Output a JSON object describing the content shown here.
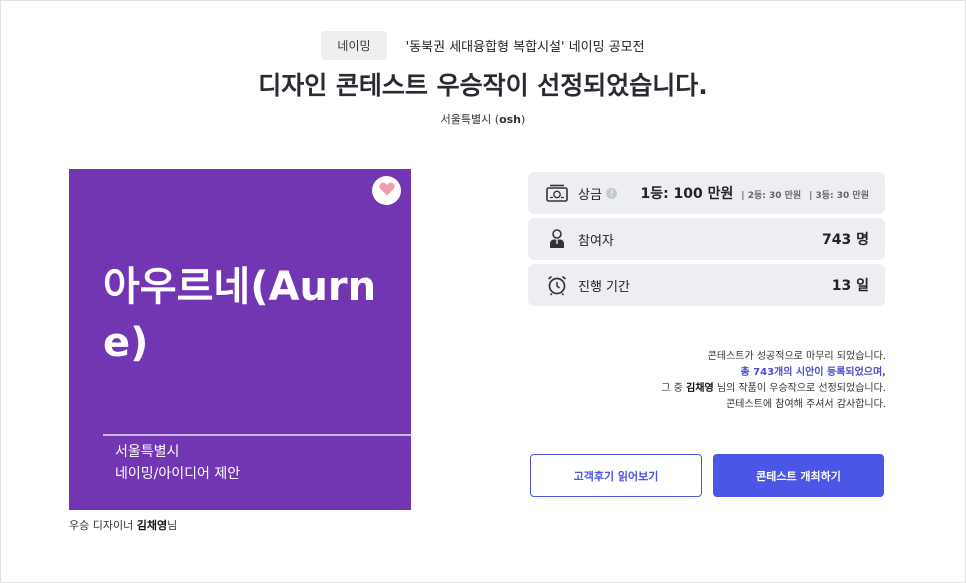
{
  "header": {
    "badge": "네이밍",
    "contest_name": "'동북권 세대융합형 복합시설' 네이밍 공모전",
    "title": "디자인 콘테스트 우승작이 선정되었습니다.",
    "host_name": "서울특별시",
    "host_id": "osh"
  },
  "artwork": {
    "background_color": "#7236b3",
    "heart_icon": "heart-icon",
    "title": "아우르네(Aurne)",
    "line1": "서울특별시",
    "line2": "네이밍/아이디어 제안"
  },
  "designer": {
    "prefix": "우승 디자이너",
    "name": "김채영",
    "suffix": "님"
  },
  "info": {
    "prize": {
      "icon": "money-icon",
      "label": "상금",
      "first": "1등: 100 만원",
      "second": "| 2등: 30 만원",
      "third": "| 3등: 30 만원"
    },
    "participants": {
      "icon": "person-icon",
      "label": "참여자",
      "value": "743 명"
    },
    "duration": {
      "icon": "alarm-clock-icon",
      "label": "진행 기간",
      "value": "13 일"
    }
  },
  "message": {
    "line1": "콘테스트가 성공적으로 마무리 되었습니다.",
    "line2": "총 743개의 시안이 등록되었으며,",
    "line3_prefix": "그 중",
    "line3_name": "김채영",
    "line3_suffix": "님의 작품이 우승작으로 선정되었습니다.",
    "line4": "콘테스트에 참여해 주셔서 감사합니다."
  },
  "buttons": {
    "review": "고객후기 읽어보기",
    "host": "콘테스트 개최하기"
  },
  "colors": {
    "accent": "#4b55e6",
    "artwork_bg": "#7236b3"
  }
}
